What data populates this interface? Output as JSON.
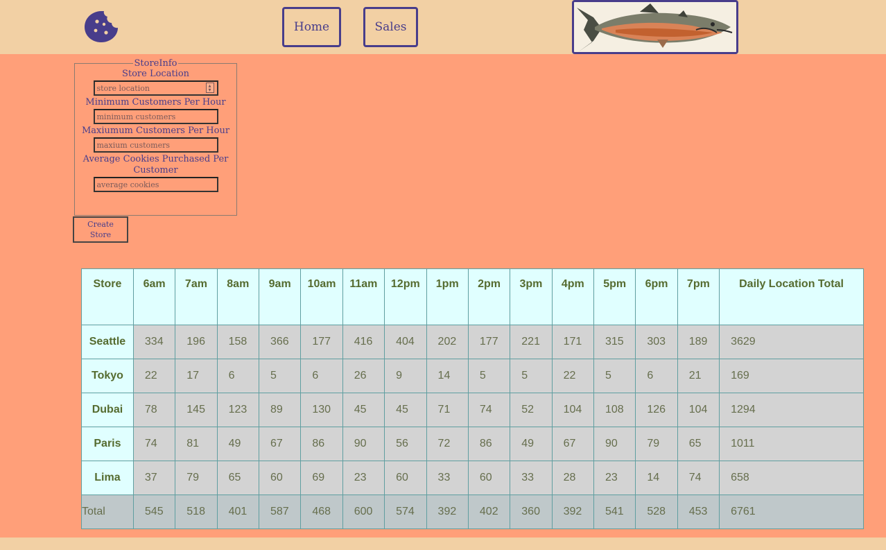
{
  "header": {
    "logo_icon": "cookie-icon",
    "nav": [
      {
        "label": "Home"
      },
      {
        "label": "Sales"
      }
    ],
    "banner_icon": "salmon-fish-image"
  },
  "form": {
    "legend": "StoreInfo",
    "location_label": "Store Location",
    "location_placeholder": "store location",
    "min_label": "Minimum Customers Per Hour",
    "min_placeholder": "minimum customers",
    "max_label": "Maxiumum Customers Per Hour",
    "max_placeholder": "maxium customers",
    "avg_label": "Average Cookies Purchased Per Customer",
    "avg_placeholder": "average cookies",
    "submit_label": "Create Store"
  },
  "table": {
    "headers": [
      "Store",
      "6am",
      "7am",
      "8am",
      "9am",
      "10am",
      "11am",
      "12pm",
      "1pm",
      "2pm",
      "3pm",
      "4pm",
      "5pm",
      "6pm",
      "7pm",
      "Daily Location Total"
    ],
    "rows": [
      {
        "store": "Seattle",
        "values": [
          "334",
          "196",
          "158",
          "366",
          "177",
          "416",
          "404",
          "202",
          "177",
          "221",
          "171",
          "315",
          "303",
          "189",
          "3629"
        ]
      },
      {
        "store": "Tokyo",
        "values": [
          "22",
          "17",
          "6",
          "5",
          "6",
          "26",
          "9",
          "14",
          "5",
          "5",
          "22",
          "5",
          "6",
          "21",
          "169"
        ]
      },
      {
        "store": "Dubai",
        "values": [
          "78",
          "145",
          "123",
          "89",
          "130",
          "45",
          "45",
          "71",
          "74",
          "52",
          "104",
          "108",
          "126",
          "104",
          "1294"
        ]
      },
      {
        "store": "Paris",
        "values": [
          "74",
          "81",
          "49",
          "67",
          "86",
          "90",
          "56",
          "72",
          "86",
          "49",
          "67",
          "90",
          "79",
          "65",
          "1011"
        ]
      },
      {
        "store": "Lima",
        "values": [
          "37",
          "79",
          "65",
          "60",
          "69",
          "23",
          "60",
          "33",
          "60",
          "33",
          "28",
          "23",
          "14",
          "74",
          "658"
        ]
      }
    ],
    "totals_label": "Total",
    "totals": [
      "545",
      "518",
      "401",
      "587",
      "468",
      "600",
      "574",
      "392",
      "402",
      "360",
      "392",
      "541",
      "528",
      "453",
      "6761"
    ]
  },
  "colors": {
    "header_bg": "#f2d0a4",
    "main_bg": "#ff9f79",
    "accent": "#483d8b",
    "table_header_bg": "#e0ffff",
    "table_cell_bg": "#d3d3d3",
    "table_text": "#556b2f"
  }
}
